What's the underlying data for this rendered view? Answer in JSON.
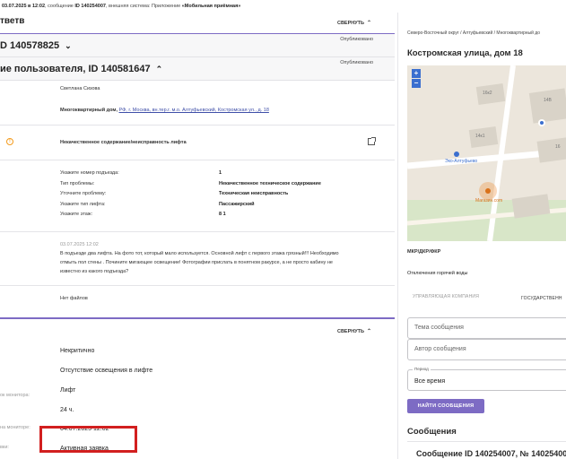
{
  "topbar": {
    "date": "03.07.2025 в 12:02",
    "prefix": ", сообщение ",
    "msg_id": "ID 140254007",
    "mid": ", внешняя система: Приложение ",
    "app": "«Мобильная приёмная»"
  },
  "answer_section": {
    "title": "тветв",
    "collapse_label": "СВЕРНУТЬ",
    "collapse_icon": "chevron-up"
  },
  "ticket_rows": [
    {
      "label": "D 140578825",
      "status": "Опубликовано",
      "chevron": "chevron-down"
    },
    {
      "label": "ие пользователя, ID 140581647",
      "status": "Опубликовано",
      "chevron": "chevron-up"
    }
  ],
  "message": {
    "author": "Светлана Сизова",
    "address_prefix": "Многоквартирный дом, ",
    "address_link": "РФ, г. Москва, вн.тер.г. м.о. Алтуфьевский, Костромская ул., д. 18",
    "problem_title": "Некачественное содержание/неисправность лифта",
    "fields": [
      {
        "key": "Укажите номер подъезда:",
        "value": "1"
      },
      {
        "key": "Тип проблемы:",
        "value": "Некачественное техническое содержание"
      },
      {
        "key": "Уточните проблему:",
        "value": "Техническая неисправность"
      },
      {
        "key": "Укажите тип лифта:",
        "value": "Пассажирский"
      },
      {
        "key": "Укажите этаж:",
        "value": "8 1"
      }
    ],
    "timestamp": "03.07.2025 12:02",
    "text_line1": "В подъезде два лифта. На фото тот, который мало используется. Основной лифт с первого этажа грязный!!! Необходимо",
    "text_line2": "отмыть пол стены . Почините мигающее освещение! Фотографии прислать в понятном ракурсе, а не просто кабину не",
    "text_line3": "известно из какого подъезда?",
    "no_files": "Нет файлов"
  },
  "details": {
    "collapse_label": "СВЕРНУТЬ",
    "items": [
      {
        "label": "",
        "value": "Некритично"
      },
      {
        "label": "",
        "value": "Отсутствие освещения в лифте"
      },
      {
        "label": "",
        "value": "Лифт"
      },
      {
        "label": "ок монитора:",
        "value": "24 ч."
      },
      {
        "label": "на мониторе:",
        "value": "04.07.2025 12:02"
      },
      {
        "label": "вки:",
        "value": "Активная заявка"
      }
    ]
  },
  "right": {
    "breadcrumb": "Северо-Восточный округ / Алтуфьевский / Многоквартирный до",
    "address": "Костромская улица, дом 18",
    "map": {
      "zoom_in": "+",
      "zoom_out": "−",
      "labels": [
        "16к2",
        "14В",
        "14к1",
        "16",
        "Эко-Алтуфьево",
        "Магазин.com"
      ]
    },
    "mkr_label": "МКР/ДКР/ФКР",
    "hot_water": "Отключения горячей воды",
    "tab_managing": "УПРАВЛЯЮЩАЯ КОМПАНИЯ",
    "tab_state": "ГОСУДАРСТВЕНН",
    "topic_placeholder": "Тема сообщения",
    "author_placeholder": "Автор сообщения",
    "period_label": "Период",
    "period_value": "Все время",
    "search_button": "НАЙТИ СООБЩЕНИЯ",
    "messages_title": "Сообщения",
    "message_item": "Сообщение ID 140254007, № 14025400"
  },
  "colors": {
    "accent": "#7d6bc4",
    "highlight": "#d21f1f",
    "warning": "#f39a1c",
    "link": "#3f4fa8"
  }
}
